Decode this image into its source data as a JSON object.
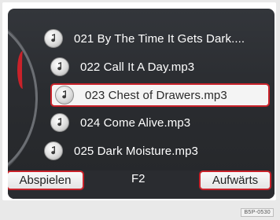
{
  "tracks": [
    {
      "label": "021 By The Time It Gets Dark....",
      "selected": false
    },
    {
      "label": "022 Call It A Day.mp3",
      "selected": false
    },
    {
      "label": "023 Chest of Drawers.mp3",
      "selected": true
    },
    {
      "label": "024 Come Alive.mp3",
      "selected": false
    },
    {
      "label": "025 Dark Moisture.mp3",
      "selected": false
    }
  ],
  "softkeys": {
    "left_label": "Abspielen",
    "center_label": "F2",
    "right_label": "Aufwärts"
  },
  "watermark": "B5P-0530",
  "colors": {
    "accent": "#c9222a",
    "screen_bg": "#2a2c30",
    "text": "#ffffff"
  },
  "icons": {
    "track": "music-note-icon"
  }
}
